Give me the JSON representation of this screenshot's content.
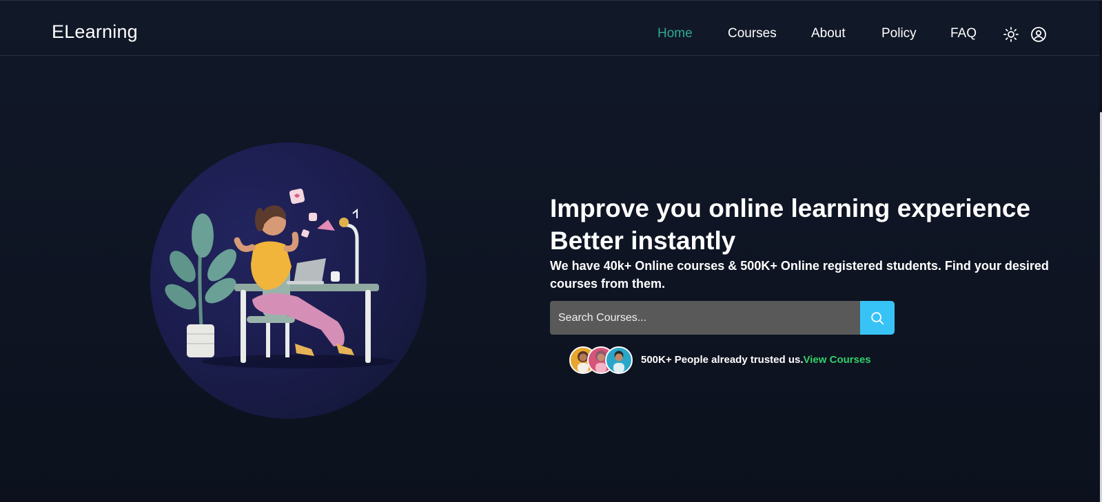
{
  "header": {
    "brand": "ELearning",
    "nav": [
      {
        "label": "Home",
        "active": true
      },
      {
        "label": "Courses",
        "active": false
      },
      {
        "label": "About",
        "active": false
      },
      {
        "label": "Policy",
        "active": false
      },
      {
        "label": "FAQ",
        "active": false
      }
    ],
    "icons": [
      "sun-icon",
      "user-icon"
    ]
  },
  "hero": {
    "headline_line1": "Improve you online learning experience",
    "headline_line2": "Better instantly",
    "subtext": "We have 40k+ Online courses & 500K+ Online registered students. Find your desired courses from them.",
    "search": {
      "placeholder": "Search Courses...",
      "value": "",
      "button_icon": "search-icon"
    },
    "trust": {
      "text": "500K+ People already trusted us.",
      "link": "View Courses"
    }
  },
  "colors": {
    "background": "#0f1524",
    "accent_active": "#2fa892",
    "search_button": "#38c3f6",
    "link_green": "#34d06a",
    "circle": "#1c1d4e"
  }
}
